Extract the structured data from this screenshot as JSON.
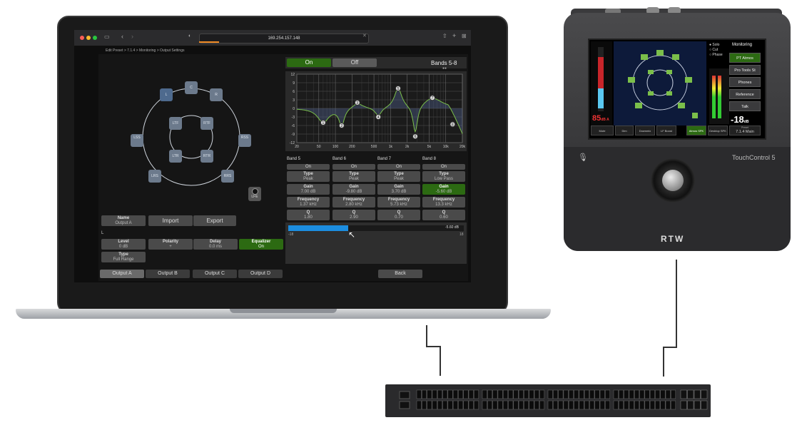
{
  "browser": {
    "url": "169.254.157.148"
  },
  "breadcrumb": "Edit Preset > 7.1.4 > Monitoring > Output Settings",
  "eq_toggle": {
    "on": "On",
    "off": "Off",
    "bands_title": "Bands 5-8"
  },
  "eq_graph": {
    "y_ticks": [
      "12",
      "9",
      "6",
      "3",
      "0",
      "-3",
      "-6",
      "-9",
      "-12"
    ],
    "x_ticks": [
      "20",
      "50",
      "100",
      "200",
      "500",
      "1k",
      "2k",
      "5k",
      "10k",
      "20k"
    ],
    "band_markers": [
      "1",
      "2",
      "3",
      "4",
      "5",
      "6",
      "7",
      "8"
    ]
  },
  "bands": [
    {
      "name": "Band 5",
      "on": "On",
      "type": "Peak",
      "gain": "7.00 dB",
      "freq": "1.37 kHz",
      "q": "1.80"
    },
    {
      "name": "Band 6",
      "on": "On",
      "type": "Peak",
      "gain": "-9.80 dB",
      "freq": "2.80 kHz",
      "q": "2.90"
    },
    {
      "name": "Band 7",
      "on": "On",
      "type": "Peak",
      "gain": "3.70 dB",
      "freq": "5.73 kHz",
      "q": "0.70"
    },
    {
      "name": "Band 8",
      "on": "On",
      "type": "Low Pass",
      "gain": "-5.60 dB",
      "freq": "13.3 kHz",
      "q": "0.60"
    }
  ],
  "param_labels": {
    "type": "Type",
    "gain": "Gain",
    "freq": "Frequency",
    "q": "Q"
  },
  "slider": {
    "value": "-5.60",
    "unit": "dB",
    "min": "-18",
    "max": "18",
    "level": 0.34
  },
  "speakers": [
    "L",
    "C",
    "R",
    "LSS",
    "RSS",
    "LRS",
    "RRS",
    "LTF",
    "RTF",
    "LTR",
    "RTR"
  ],
  "lfe": "LFE",
  "preset": {
    "name_label": "Name",
    "name_value": "Output A",
    "import": "Import",
    "export": "Export"
  },
  "channel": "L",
  "settings": [
    {
      "label": "Level",
      "value": "0 dB"
    },
    {
      "label": "Polarity",
      "value": "+"
    },
    {
      "label": "Delay",
      "value": "0.0 ms"
    },
    {
      "label": "Equalizer",
      "value": "On"
    }
  ],
  "type_setting": {
    "label": "Type",
    "value": "Full Range"
  },
  "tabs": [
    "Output A",
    "Output B",
    "Output C",
    "Output D"
  ],
  "back": "Back",
  "device": {
    "brand": "TouchControl 5",
    "logo": "RTW",
    "level": "85",
    "level_unit": "dB A",
    "meter_value": "-18",
    "meter_unit": "dB",
    "radio": [
      "Solo",
      "Cut",
      "Phase"
    ],
    "monitoring_title": "Monitoring",
    "menu": [
      "PT Atmos",
      "Pro Tools St",
      "Phones",
      "Reference",
      "Talk"
    ],
    "bottom": [
      "Mute",
      "Dim",
      "Downmix",
      "LF Boost",
      "Atmos SPK",
      "Desktop SPK"
    ],
    "preset": "7.1.4 Main",
    "preset_label": "Preset"
  },
  "colors": {
    "green": "#2c6a12",
    "blue": "#1c8ddf",
    "accent_green": "#7bbf4a"
  }
}
